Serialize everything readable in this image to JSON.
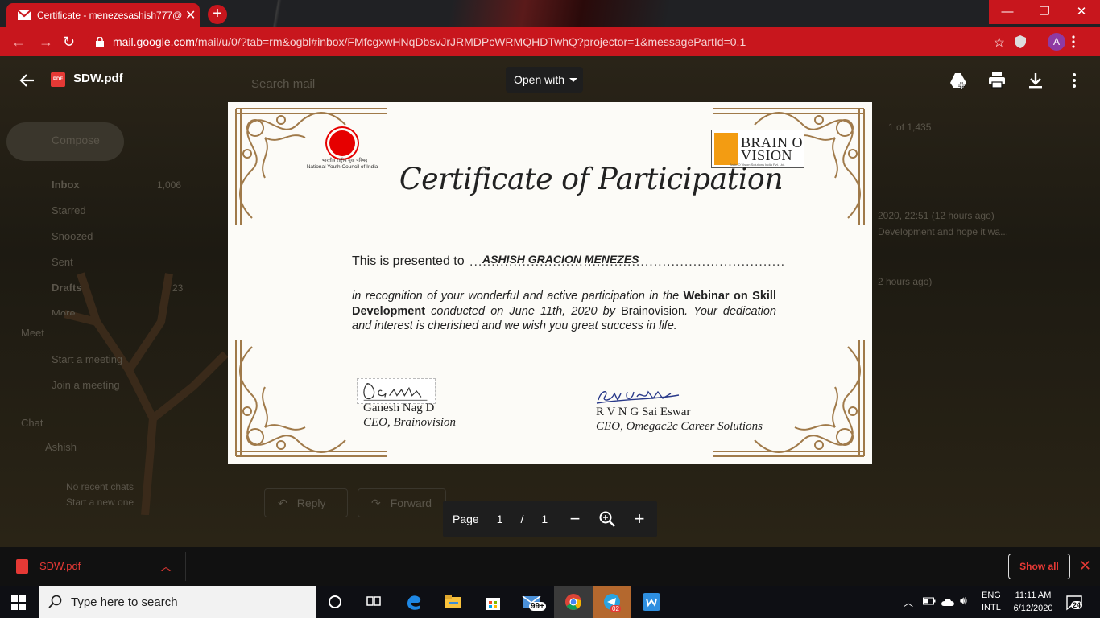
{
  "browser": {
    "tab_title": "Certificate - menezesashish777@",
    "tab_close": "✕",
    "new_tab": "+",
    "url_host": "mail.google.com",
    "url_rest": "/mail/u/0/?tab=rm&ogbl#inbox/FMfcgxwHNqDbsvJrJRMDPcWRMQHDTwhQ?projector=1&messagePartId=0.1",
    "avatar_letter": "A",
    "accent": "#c8161d"
  },
  "gmail_bg": {
    "search_placeholder": "Search mail",
    "compose": "Compose",
    "nav": [
      {
        "label": "Inbox",
        "count": "1,006"
      },
      {
        "label": "Starred",
        "count": ""
      },
      {
        "label": "Snoozed",
        "count": ""
      },
      {
        "label": "Sent",
        "count": ""
      },
      {
        "label": "Drafts",
        "count": "23"
      },
      {
        "label": "More",
        "count": ""
      }
    ],
    "meet_header": "Meet",
    "meet_items": [
      "Start a meeting",
      "Join a meeting"
    ],
    "chat_header": "Chat",
    "chat_user": "Ashish",
    "no_chats": "No recent chats",
    "start_chat": "Start a new one",
    "pager": "1 of 1,435",
    "msg_time1": "2020, 22:51 (12 hours ago)",
    "msg_snippet": "Development and hope it wa...",
    "msg_time2": "2 hours ago)",
    "reply": "Reply",
    "forward": "Forward"
  },
  "viewer": {
    "file_name": "SDW.pdf",
    "pdf_badge": "PDF",
    "open_with": "Open with",
    "page_label": "Page",
    "page_current": "1",
    "page_sep": "/",
    "page_total": "1"
  },
  "certificate": {
    "org_left_hindi": "भारतीय राष्ट्रीय युवा परिषद",
    "org_left_en": "National Youth Council of India",
    "org_right_line1": "BRAIN O",
    "org_right_line2": "VISION",
    "org_right_sub": "Brain O Vision Solutions India Pvt. Ltd.",
    "title": "Certificate of Participation",
    "presented_to": "This is presented to",
    "dots": "..............................................................................",
    "recipient": "ASHISH GRACION MENEZES",
    "body_1": "in recognition of your wonderful and active participation in the ",
    "body_bold1": "Webinar on Skill Development",
    "body_2": " conducted on June 11th, 2020 by ",
    "body_org": "Brainovision",
    "body_3": ". Your dedication and interest is cherished and we wish you great success in life.",
    "sig1_name": "Ganesh Nag D",
    "sig1_role": "CEO, Brainovision",
    "sig2_name": "R V N G Sai Eswar",
    "sig2_role": "CEO, Omegac2c Career Solutions",
    "ornament_color": "#a07a4a"
  },
  "download_bar": {
    "file": "SDW.pdf",
    "show_all": "Show all"
  },
  "taskbar": {
    "search_placeholder": "Type here to search",
    "mail_badge": "99+",
    "telegram_badge": "02",
    "lang1": "ENG",
    "lang2": "INTL",
    "time": "11:11 AM",
    "date": "6/12/2020",
    "notif_count": "24"
  }
}
